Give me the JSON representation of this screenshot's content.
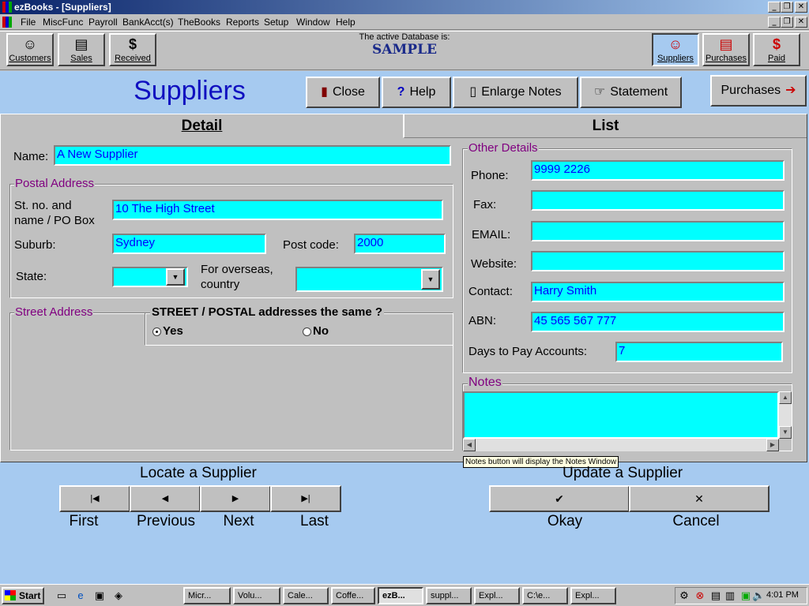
{
  "window": {
    "title": "ezBooks - [Suppliers]"
  },
  "menu": [
    "File",
    "MiscFunc",
    "Payroll",
    "BankAcct(s)",
    "TheBooks",
    "Reports",
    "Setup",
    "Window",
    "Help"
  ],
  "toolbar": {
    "left": [
      {
        "label": "Customers",
        "icon": "smiley-icon"
      },
      {
        "label": "Sales",
        "icon": "documents-icon"
      },
      {
        "label": "Received",
        "icon": "dollar-icon"
      }
    ],
    "right": [
      {
        "label": "Suppliers",
        "icon": "smiley-icon"
      },
      {
        "label": "Purchases",
        "icon": "documents-icon"
      },
      {
        "label": "Paid",
        "icon": "dollar-icon"
      }
    ],
    "db_caption": "The active Database is:",
    "db_name": "SAMPLE"
  },
  "page": {
    "title": "Suppliers",
    "buttons": {
      "close": "Close",
      "help": "Help",
      "enlarge": "Enlarge Notes",
      "statement": "Statement",
      "purchases": "Purchases"
    }
  },
  "tabs": {
    "detail": "Detail",
    "list": "List"
  },
  "form": {
    "name_label": "Name:",
    "name_value": "A New Supplier",
    "postal": {
      "legend": "Postal Address",
      "street_label_1": "St. no. and",
      "street_label_2": "name / PO Box",
      "street_value": "10 The High Street",
      "suburb_label": "Suburb:",
      "suburb_value": "Sydney",
      "postcode_label": "Post code:",
      "postcode_value": "2000",
      "state_label": "State:",
      "state_value": "",
      "country_label_1": "For overseas,",
      "country_label_2": "country",
      "country_value": ""
    },
    "street": {
      "legend": "Street Address",
      "same_question": "STREET / POSTAL addresses the same ?",
      "yes": "Yes",
      "no": "No",
      "selected": "Yes"
    },
    "other": {
      "legend": "Other Details",
      "phone_label": "Phone:",
      "phone_value": "9999 2226",
      "fax_label": "Fax:",
      "fax_value": "",
      "email_label": "EMAIL:",
      "email_value": "",
      "website_label": "Website:",
      "website_value": "",
      "contact_label": "Contact:",
      "contact_value": "Harry Smith",
      "abn_label": "ABN:",
      "abn_value": "45 565  567 777",
      "days_label": "Days to Pay Accounts:",
      "days_value": "7"
    },
    "notes": {
      "legend": "Notes",
      "value": "",
      "tooltip": "Notes button will display the Notes Window"
    }
  },
  "nav": {
    "locate_title": "Locate a Supplier",
    "first": "First",
    "previous": "Previous",
    "next": "Next",
    "last": "Last",
    "update_title": "Update a Supplier",
    "okay": "Okay",
    "cancel": "Cancel"
  },
  "taskbar": {
    "start": "Start",
    "tasks": [
      "Micr...",
      "Volu...",
      "Cale...",
      "Coffe...",
      "ezB...",
      "suppl...",
      "Expl...",
      "C:\\e...",
      "Expl..."
    ],
    "active_task": "ezB...",
    "clock": "4:01 PM"
  },
  "colors": {
    "field": "#00ffff",
    "accent": "#1010c0",
    "legend": "#800080",
    "blue_bg": "#a6caf0"
  }
}
